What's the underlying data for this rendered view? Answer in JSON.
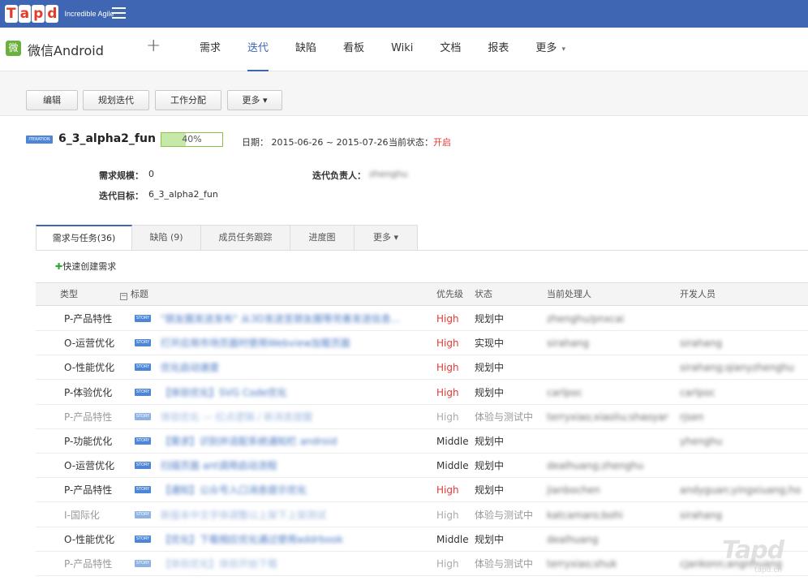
{
  "app": {
    "logo_letters": [
      "T",
      "a",
      "p",
      "d"
    ],
    "tagline": "Incredible Agile"
  },
  "project": {
    "icon_char": "微",
    "name": "微信Android"
  },
  "nav": {
    "plus": "+",
    "items": [
      {
        "label": "需求"
      },
      {
        "label": "迭代",
        "active": true
      },
      {
        "label": "缺陷"
      },
      {
        "label": "看板"
      },
      {
        "label": "Wiki"
      },
      {
        "label": "文档"
      },
      {
        "label": "报表"
      },
      {
        "label": "更多"
      }
    ],
    "more_caret": "▾"
  },
  "toolbar": {
    "edit": "编辑",
    "plan": "规划迭代",
    "assign": "工作分配",
    "more": "更多 ▾"
  },
  "iteration": {
    "badge": "ITERATION",
    "name": "6_3_alpha2_fun",
    "progress_percent": 40,
    "progress_text": "40%",
    "date": "日期： 2015-06-26 ~ 2015-07-26",
    "status_label": "当前状态：",
    "status_value": "开启",
    "scope_label": "需求规模：",
    "scope_value": "0",
    "owner_label": "迭代负责人：",
    "owner_value": "zhenghu",
    "goal_label": "迭代目标：",
    "goal_value": "6_3_alpha2_fun"
  },
  "tabs": [
    {
      "label": "需求与任务(36)",
      "active": true
    },
    {
      "label": "缺陷 (9)"
    },
    {
      "label": "成员任务跟踪"
    },
    {
      "label": "进度图"
    },
    {
      "label": "更多 ▾"
    }
  ],
  "quick_add": {
    "plus": "✚",
    "label": "快速创建需求"
  },
  "table": {
    "headers": {
      "type": "类型",
      "collapse": "−",
      "title": "标题",
      "priority": "优先级",
      "status": "状态",
      "handler": "当前处理人",
      "developer": "开发人员"
    },
    "story_tag": "STORY",
    "rows": [
      {
        "type": "P-产品特性",
        "title": "\"朋友圈发送发布\" 从3D发送至朋友圈等完善发送信息...",
        "priority": "High",
        "status": "规划中",
        "handler": "zhenghu/pnxcai",
        "developer": "",
        "faded": false
      },
      {
        "type": "O-运营优化",
        "title": "打开应用市场页面时使用Webview加载页面",
        "priority": "High",
        "status": "实现中",
        "handler": "sirahang",
        "developer": "sirahang",
        "faded": false
      },
      {
        "type": "O-性能优化",
        "title": "优化启动速度",
        "priority": "High",
        "status": "规划中",
        "handler": "",
        "developer": "sirahang;qianyzhenghu",
        "faded": false
      },
      {
        "type": "P-体验优化",
        "title": "【体验优化】SVG Code优化",
        "priority": "High",
        "status": "规划中",
        "handler": "carlpoc",
        "developer": "carlpoc",
        "faded": false
      },
      {
        "type": "P-产品特性",
        "title": "体验优化 — 红点逻辑 / 新消息提醒",
        "priority": "High",
        "status": "体验与测试中",
        "handler": "terryxiao;xiaoliu;shaoyang",
        "developer": "rjsen",
        "faded": true
      },
      {
        "type": "P-功能优化",
        "title": "【需求】识别并适配系统通知栏 android",
        "priority": "Middle",
        "status": "规划中",
        "handler": "",
        "developer": "yhenghu",
        "faded": false
      },
      {
        "type": "O-运营优化",
        "title": "扫描页面 ant调用启动流程",
        "priority": "Middle",
        "status": "规划中",
        "handler": "dealhuang;zhenghu",
        "developer": "",
        "faded": false
      },
      {
        "type": "P-产品特性",
        "title": "【通知】公众号入口消息提示优化",
        "priority": "High",
        "status": "规划中",
        "handler": "jianbochen",
        "developer": "andyguan;yingxiuang;hoga...",
        "faded": false
      },
      {
        "type": "I-国际化",
        "title": "新版本中文字体调整以上架下上架测试",
        "priority": "High",
        "status": "体验与测试中",
        "handler": "katcamaro;bohi",
        "developer": "sirahang",
        "faded": true
      },
      {
        "type": "O-性能优化",
        "title": "【优化】下载相应优化通过使用addrbook",
        "priority": "Middle",
        "status": "规划中",
        "handler": "dealhuang",
        "developer": "",
        "faded": false
      },
      {
        "type": "P-产品特性",
        "title": "【体验优化】体验开始下载",
        "priority": "High",
        "status": "体验与测试中",
        "handler": "terryxiao;shuk",
        "developer": "cjankonn;angnhuang",
        "faded": true
      }
    ]
  },
  "watermark": {
    "text": "Tapd",
    "sub": "tapd.cn"
  }
}
